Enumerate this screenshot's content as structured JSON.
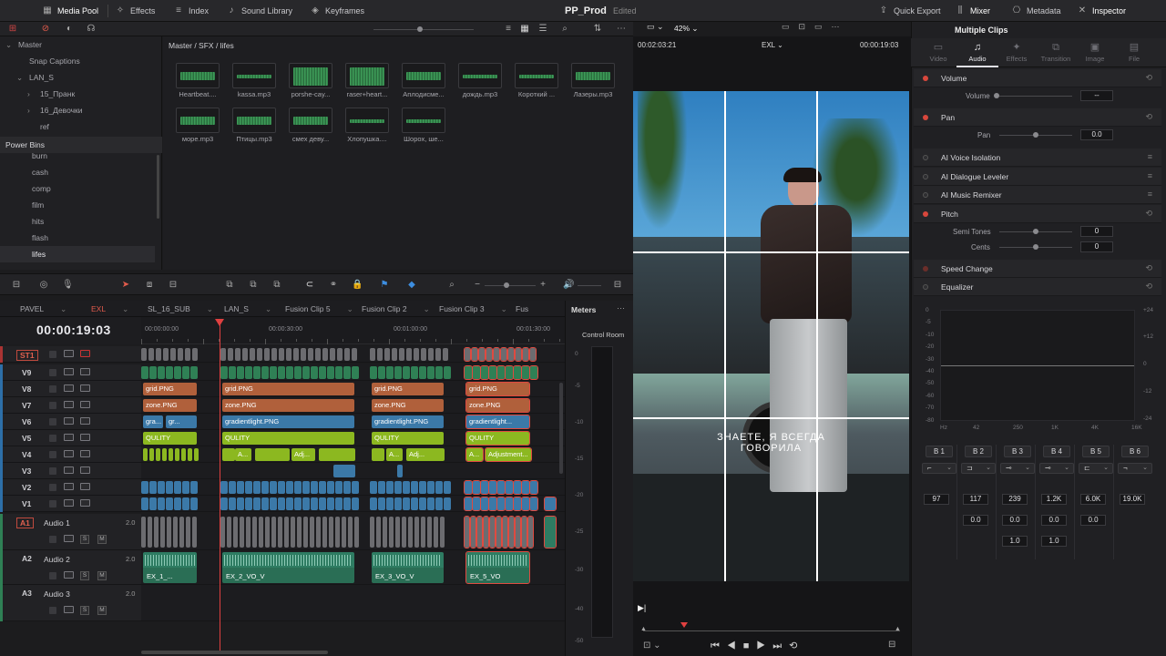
{
  "topbar": {
    "media_pool": "Media Pool",
    "effects": "Effects",
    "index": "Index",
    "sound_library": "Sound Library",
    "keyframes": "Keyframes",
    "project": "PP_Prod",
    "status": "Edited",
    "quick_export": "Quick Export",
    "mixer": "Mixer",
    "metadata": "Metadata",
    "inspector": "Inspector",
    "zoom": "42%"
  },
  "bins": {
    "items": [
      {
        "label": "Master",
        "indent": 0,
        "arrow": "⌄"
      },
      {
        "label": "Snap Captions",
        "indent": 1,
        "arrow": ""
      },
      {
        "label": "LAN_S",
        "indent": 1,
        "arrow": "⌄"
      },
      {
        "label": "15_Пранк",
        "indent": 2,
        "arrow": "›"
      },
      {
        "label": "16_Девочки",
        "indent": 2,
        "arrow": "›"
      },
      {
        "label": "ref",
        "indent": 2,
        "arrow": ""
      }
    ],
    "power_bins_title": "Power Bins",
    "power_items": [
      "burn",
      "cash",
      "comp",
      "film",
      "hits",
      "flash",
      "lifes"
    ],
    "selected": "lifes"
  },
  "media_pool": {
    "path": "Master / SFX / lifes",
    "clips": [
      "Heartbeat....",
      "kassa.mp3",
      "porshe-cay...",
      "raser+heart...",
      "Аплодисме...",
      "дождь.mp3",
      "Короткий ...",
      "Лазеры.mp3",
      "море.mp3",
      "Птицы.mp3",
      "смех деву...",
      "Хлопушка....",
      "Шорох, ше..."
    ]
  },
  "viewer": {
    "timecode_left": "00:02:03:21",
    "timeline_name": "EXL",
    "timecode_right": "00:00:19:03",
    "caption_line1": "ЗНАЕТЕ, Я ВСЕГДА",
    "caption_line2": "ГОВОРИЛА"
  },
  "timeline": {
    "timecode": "00:00:19:03",
    "tabs": [
      "PAVEL",
      "EXL",
      "SL_16_SUB",
      "LAN_S",
      "Fusion Clip 5",
      "Fusion Clip 2",
      "Fusion Clip 3",
      "Fus"
    ],
    "active_tab": "EXL",
    "ruler": [
      "00:00:00:00",
      "00:00:30:00",
      "00:01:00:00",
      "00:01:30:00"
    ],
    "tracks": [
      "ST1",
      "V9",
      "V8",
      "V7",
      "V6",
      "V5",
      "V4",
      "V3",
      "V2",
      "V1"
    ],
    "audio_tracks": [
      {
        "id": "A1",
        "name": "Audio 1",
        "level": "2.0"
      },
      {
        "id": "A2",
        "name": "Audio 2",
        "level": "2.0"
      },
      {
        "id": "A3",
        "name": "Audio 3",
        "level": "2.0"
      }
    ],
    "clip_grid": "grid.PNG",
    "clip_zone": "zone.PNG",
    "clip_gradient": "gradientlight.PNG",
    "clip_gradient_short": "gradientlight...",
    "clip_gr1": "gra...",
    "clip_gr2": "gr...",
    "clip_quality": "QULITY",
    "clip_adj": "Adj...",
    "clip_adj2": "Adjustment...",
    "clip_a": "A...",
    "audio_clips": [
      "EX_1_...",
      "EX_2_VO_V",
      "EX_3_VO_V",
      "EX_5_VO"
    ]
  },
  "meters": {
    "title": "Meters",
    "control_room": "Control Room",
    "scale": [
      "0",
      "-5",
      "-10",
      "-15",
      "-20",
      "-25",
      "-30",
      "-40",
      "-50"
    ]
  },
  "inspector": {
    "title": "Multiple Clips",
    "tabs": [
      {
        "label": "Video",
        "icon": "▭"
      },
      {
        "label": "Audio",
        "icon": "♫"
      },
      {
        "label": "Effects",
        "icon": "✦"
      },
      {
        "label": "Transition",
        "icon": "⧉"
      },
      {
        "label": "Image",
        "icon": "▣"
      },
      {
        "label": "File",
        "icon": "▤"
      }
    ],
    "active_tab": "Audio",
    "volume": {
      "title": "Volume",
      "param": "Volume",
      "value": "--"
    },
    "pan": {
      "title": "Pan",
      "param": "Pan",
      "value": "0.0"
    },
    "ai_voice": "AI Voice Isolation",
    "ai_dialogue": "AI Dialogue Leveler",
    "ai_music": "AI Music Remixer",
    "pitch": {
      "title": "Pitch",
      "semi": "Semi Tones",
      "semi_value": "0",
      "cents": "Cents",
      "cents_value": "0"
    },
    "speed": "Speed Change",
    "equalizer": {
      "title": "Equalizer",
      "db_left": [
        "0",
        "-5",
        "-10",
        "-20",
        "-30",
        "-40",
        "-50",
        "-60",
        "-70",
        "-80"
      ],
      "db_right": [
        "+24",
        "+12",
        "0",
        "-12",
        "-24"
      ],
      "freq": [
        "Hz",
        "42",
        "250",
        "1K",
        "4K",
        "16K"
      ],
      "bands": [
        "B 1",
        "B 2",
        "B 3",
        "B 4",
        "B 5",
        "B 6"
      ],
      "freq_values": [
        "97",
        "117",
        "239",
        "1.2K",
        "6.0K",
        "19.0K"
      ],
      "gain_values": [
        "0.0",
        "0.0",
        "0.0",
        "0.0"
      ],
      "q_values": [
        "1.0",
        "1.0"
      ]
    }
  }
}
